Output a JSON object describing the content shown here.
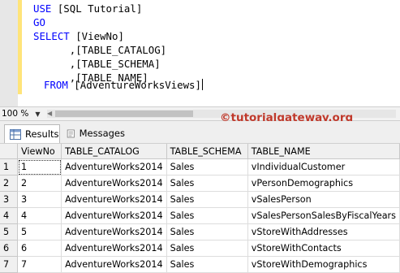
{
  "editor": {
    "lines": [
      {
        "kw": "USE",
        "rest": " [SQL Tutorial]"
      },
      {
        "kw": "GO",
        "rest": ""
      },
      {
        "kw": "SELECT",
        "rest": " [ViewNo]"
      },
      {
        "rest": "      ,[TABLE_CATALOG]"
      },
      {
        "rest": "      ,[TABLE_SCHEMA]"
      },
      {
        "rest": "      ,[TABLE_NAME]"
      },
      {
        "kw": "FROM",
        "rest": " [AdventureWorksViews]"
      }
    ]
  },
  "watermark": "©tutorialgateway.org",
  "zoom": {
    "value": "100 %"
  },
  "tabs": {
    "results": "Results",
    "messages": "Messages"
  },
  "grid": {
    "columns": [
      "ViewNo",
      "TABLE_CATALOG",
      "TABLE_SCHEMA",
      "TABLE_NAME"
    ],
    "rows": [
      {
        "n": "1",
        "cells": [
          "1",
          "AdventureWorks2014",
          "Sales",
          "vIndividualCustomer"
        ]
      },
      {
        "n": "2",
        "cells": [
          "2",
          "AdventureWorks2014",
          "Sales",
          "vPersonDemographics"
        ]
      },
      {
        "n": "3",
        "cells": [
          "3",
          "AdventureWorks2014",
          "Sales",
          "vSalesPerson"
        ]
      },
      {
        "n": "4",
        "cells": [
          "4",
          "AdventureWorks2014",
          "Sales",
          "vSalesPersonSalesByFiscalYears"
        ]
      },
      {
        "n": "5",
        "cells": [
          "5",
          "AdventureWorks2014",
          "Sales",
          "vStoreWithAddresses"
        ]
      },
      {
        "n": "6",
        "cells": [
          "6",
          "AdventureWorks2014",
          "Sales",
          "vStoreWithContacts"
        ]
      },
      {
        "n": "7",
        "cells": [
          "7",
          "AdventureWorks2014",
          "Sales",
          "vStoreWithDemographics"
        ]
      }
    ]
  }
}
